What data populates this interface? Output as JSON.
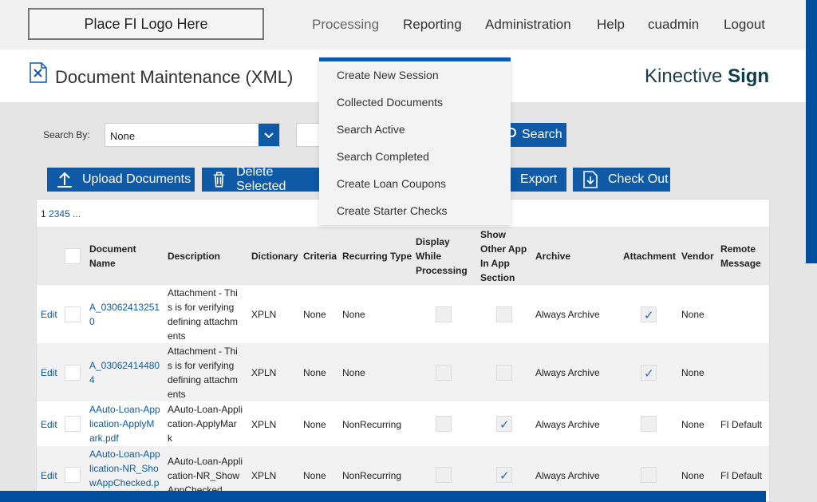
{
  "header": {
    "logo_text": "Place FI Logo Here",
    "nav": [
      "Processing",
      "Reporting",
      "Administration",
      "Help",
      "cuadmin",
      "Logout"
    ]
  },
  "page": {
    "title": "Document Maintenance (XML)",
    "brand_prefix": "Kinective",
    "brand_bold": "Sign"
  },
  "search": {
    "label": "Search By:",
    "selected": "None",
    "button": "Search"
  },
  "toolbar": {
    "upload": "Upload Documents",
    "delete": "Delete Selected",
    "export": "Export",
    "checkout": "Check Out"
  },
  "pager": {
    "current": "1",
    "pages": [
      "2",
      "3",
      "4",
      "5"
    ],
    "more": "..."
  },
  "table": {
    "headers": {
      "doc_name": [
        "Document",
        "Name"
      ],
      "description": "Description",
      "dictionary": "Dictionary",
      "criteria": "Criteria",
      "recurring": "Recurring Type",
      "display": [
        "Display",
        "While",
        "Processing"
      ],
      "show_other": [
        "Show",
        "Other App",
        "In App",
        "Section"
      ],
      "archive": "Archive",
      "attachment": "Attachment",
      "vendor": "Vendor",
      "remote": [
        "Remote",
        "Message"
      ]
    },
    "rows": [
      {
        "edit": "Edit",
        "name": [
          "A_03062413251",
          "0"
        ],
        "description": [
          "Attachment - Thi",
          "s is for verifying",
          "defining attachm",
          "ents"
        ],
        "dictionary": "XPLN",
        "criteria": "None",
        "recurring": "None",
        "display": false,
        "show_other": false,
        "archive": "Always Archive",
        "attachment": true,
        "vendor": "None",
        "remote": ""
      },
      {
        "edit": "Edit",
        "name": [
          "A_03062414480",
          "4"
        ],
        "description": [
          "Attachment - Thi",
          "s is for verifying",
          "defining attachm",
          "ents"
        ],
        "dictionary": "XPLN",
        "criteria": "None",
        "recurring": "None",
        "display": false,
        "show_other": false,
        "archive": "Always Archive",
        "attachment": true,
        "vendor": "None",
        "remote": ""
      },
      {
        "edit": "Edit",
        "name": [
          "AAuto-Loan-App",
          "lication-ApplyM",
          "ark.pdf"
        ],
        "description": [
          "AAuto-Loan-Appli",
          "cation-ApplyMar",
          "k"
        ],
        "dictionary": "XPLN",
        "criteria": "None",
        "recurring": "NonRecurring",
        "display": false,
        "show_other": true,
        "archive": "Always Archive",
        "attachment": false,
        "vendor": "None",
        "remote": "FI Default"
      },
      {
        "edit": "Edit",
        "name": [
          "AAuto-Loan-App",
          "lication-NR_Sho",
          "wAppChecked.p"
        ],
        "description": [
          "AAuto-Loan-Appli",
          "cation-NR_Show",
          "AppChecked"
        ],
        "dictionary": "XPLN",
        "criteria": "None",
        "recurring": "NonRecurring",
        "display": false,
        "show_other": true,
        "archive": "Always Archive",
        "attachment": false,
        "vendor": "None",
        "remote": "FI Default"
      }
    ]
  },
  "dropdown": {
    "items": [
      "Create New Session",
      "Collected Documents",
      "Search Active",
      "Search Completed",
      "Create Loan Coupons",
      "Create Starter Checks"
    ]
  },
  "colors": {
    "accent": "#0e5aa7",
    "stripe": "#004f9f"
  },
  "check_glyph": "✓"
}
